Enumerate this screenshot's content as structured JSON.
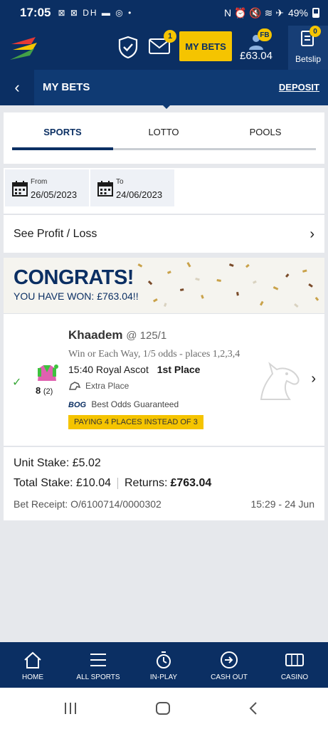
{
  "status_bar": {
    "time": "17:05",
    "left_icons": "⊠ ⊠ DH ▬ ◎ •",
    "battery": "49%",
    "right_icons": "N ⏰ 🔇 ≋ ✈"
  },
  "header": {
    "mail_count": "1",
    "my_bets_label": "MY BETS",
    "fb_badge": "FB",
    "balance": "£63.04",
    "betslip_count": "0",
    "betslip_label": "Betslip"
  },
  "titlebar": {
    "back": "‹",
    "title": "MY BETS",
    "deposit": "DEPOSIT"
  },
  "tabs": [
    {
      "label": "SPORTS",
      "active": true
    },
    {
      "label": "LOTTO",
      "active": false
    },
    {
      "label": "POOLS",
      "active": false
    }
  ],
  "dates": {
    "from_label": "From",
    "from_value": "26/05/2023",
    "to_label": "To",
    "to_value": "24/06/2023"
  },
  "profit_loss": {
    "label": "See Profit / Loss",
    "chevron": "›"
  },
  "congrats": {
    "title": "CONGRATS!",
    "message": "YOU HAVE WON: £763.04!!"
  },
  "bet": {
    "check": "✓",
    "saddle_number": "8",
    "draw": "(2)",
    "horse": "Khaadem",
    "odds": "@ 125/1",
    "market": "Win or Each Way, 1/5 odds - places 1,2,3,4",
    "race": "15:40 Royal Ascot",
    "result": "1st Place",
    "extra_place": "Extra Place",
    "bog_tag": "BOG",
    "bog_text": "Best Odds Guaranteed",
    "paying": "PAYING 4 PLACES INSTEAD OF 3",
    "chevron": "›"
  },
  "stakes": {
    "unit_stake": "Unit Stake: £5.02",
    "total_stake": "Total Stake: £10.04",
    "returns_label": "Returns:",
    "returns_value": "£763.04",
    "receipt": "Bet Receipt:  O/6100714/0000302",
    "receipt_time": "15:29 - 24 Jun"
  },
  "bottom_nav": [
    {
      "label": "HOME",
      "icon": "home-icon"
    },
    {
      "label": "ALL SPORTS",
      "icon": "menu-icon"
    },
    {
      "label": "IN-PLAY",
      "icon": "stopwatch-icon"
    },
    {
      "label": "CASH OUT",
      "icon": "cash-out-icon"
    },
    {
      "label": "CASINO",
      "icon": "slot-machine-icon"
    }
  ],
  "colors": {
    "brand_navy": "#0b2f63",
    "accent_yellow": "#f5c400",
    "success_green": "#3aa93a"
  }
}
